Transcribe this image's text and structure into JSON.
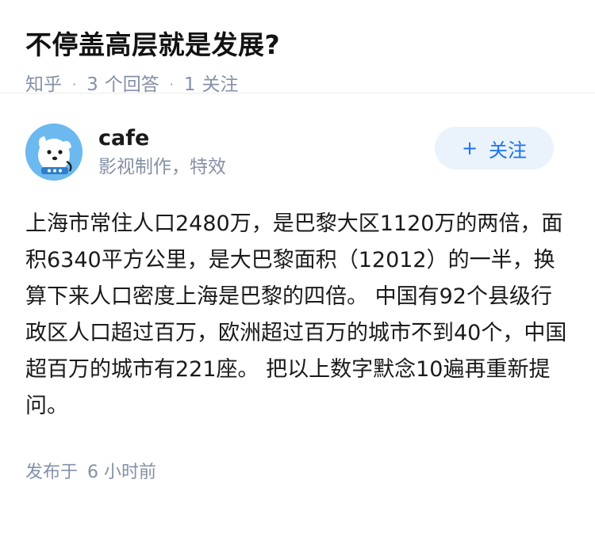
{
  "question": {
    "title": "不停盖高层就是发展?",
    "source": "知乎",
    "answer_count": "3",
    "answer_label": "个回答",
    "follow_count": "1",
    "follow_label": "关注"
  },
  "answer": {
    "author": {
      "name": "cafe",
      "headline": "影视制作，特效",
      "avatar_icon": "cartoon-dog-avatar",
      "avatar_color": "#5fb3ec"
    },
    "follow_button": {
      "icon": "plus-icon",
      "label": "关注",
      "text_color": "#1772f6",
      "bg_color": "#eaf2fb"
    },
    "content": "上海市常住人口2480万，是巴黎大区1120万的两倍，面积6340平方公里，是大巴黎面积（12012）的一半，换算下来人口密度上海是巴黎的四倍。 中国有92个县级行政区人口超过百万，欧洲超过百万的城市不到40个，中国超百万的城市有221座。 把以上数字默念10遍再重新提问。",
    "published_label": "发布于",
    "published_time": "6 小时前"
  },
  "colors": {
    "meta_gray": "#8590a6",
    "title_black": "#121212"
  }
}
